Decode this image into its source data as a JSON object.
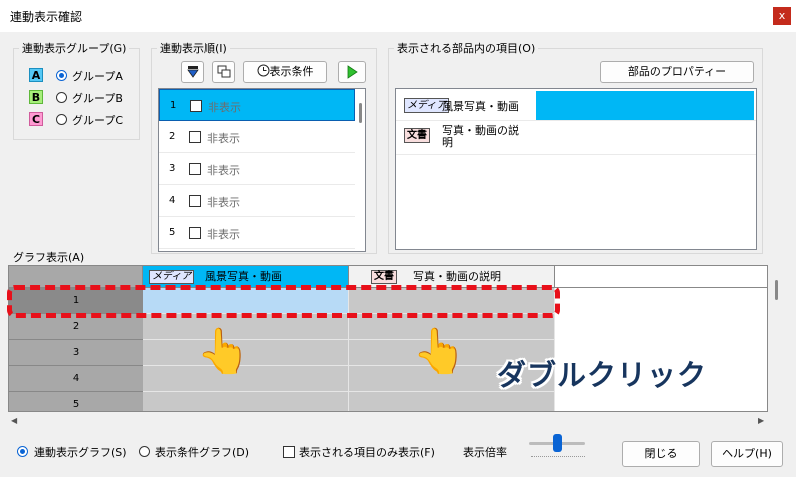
{
  "window": {
    "title": "連動表示確認",
    "close_symbol": "x"
  },
  "group_box": {
    "title": "連動表示グループ(G)",
    "items": [
      {
        "badge": "A",
        "label": "グループA",
        "color": "#55c8f5",
        "selected": true
      },
      {
        "badge": "B",
        "label": "グループB",
        "color": "#a6ee7a",
        "selected": false
      },
      {
        "badge": "C",
        "label": "グループC",
        "color": "#ff9ad2",
        "selected": false
      }
    ]
  },
  "order_box": {
    "title": "連動表示順(I)",
    "toolbar": {
      "cond_label": "表示条件"
    },
    "rows": [
      {
        "num": "1",
        "label": "非表示",
        "selected": true
      },
      {
        "num": "2",
        "label": "非表示",
        "selected": false
      },
      {
        "num": "3",
        "label": "非表示",
        "selected": false
      },
      {
        "num": "4",
        "label": "非表示",
        "selected": false
      },
      {
        "num": "5",
        "label": "非表示",
        "selected": false
      }
    ]
  },
  "items_box": {
    "title": "表示される部品内の項目(O)",
    "props_button": "部品のプロパティー",
    "items": [
      {
        "tag": "メディア",
        "label": "風景写真・動画"
      },
      {
        "tag": "文書",
        "label_line1": "写真・動画の説",
        "label_line2": "明"
      }
    ]
  },
  "graph": {
    "title": "グラフ表示(A)",
    "columns": [
      {
        "tag": "メディア",
        "label": "風景写真・動画"
      },
      {
        "tag": "文書",
        "label": "写真・動画の説明"
      }
    ],
    "rows": [
      "1",
      "2",
      "3",
      "4",
      "5"
    ],
    "annotation": "ダブルクリック",
    "highlight_color": "#e8101a",
    "selection_color": "#b7daf6"
  },
  "footer": {
    "radio1": "連動表示グラフ(S)",
    "radio2": "表示条件グラフ(D)",
    "checkbox": "表示される項目のみ表示(F)",
    "zoom_label": "表示倍率",
    "close_button": "閉じる",
    "help_button": "ヘルプ(H)"
  },
  "accent": "#00b7f5"
}
